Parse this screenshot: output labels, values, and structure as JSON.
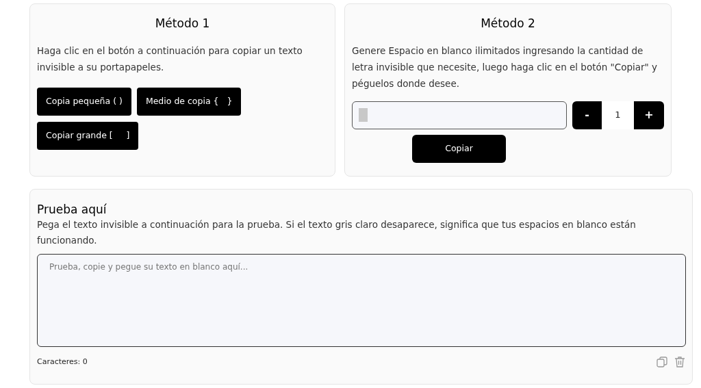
{
  "method1": {
    "title": "Método 1",
    "description": "Haga clic en el botón a continuación para copiar un texto invisible a su portapapeles.",
    "buttons": [
      "Copia pequeña ( )",
      "Medio de copia {   }",
      "Copiar grande [     ]"
    ]
  },
  "method2": {
    "title": "Método 2",
    "description": "Genere Espacio en blanco ilimitados ingresando la cantidad de letra invisible que necesite, luego haga clic en el botón \"Copiar\" y péguelos donde desee.",
    "stepper": {
      "minus": "-",
      "value": "1",
      "plus": "+"
    },
    "copy_button": "Copiar"
  },
  "test": {
    "title": "Prueba aquí",
    "description": "Pega el texto invisible a continuación para la prueba. Si el texto gris claro desaparece, significa que tus espacios en blanco están funcionando.",
    "placeholder": "Prueba, copie y pegue su texto en blanco aquí...",
    "char_count": "Caracteres: 0"
  }
}
